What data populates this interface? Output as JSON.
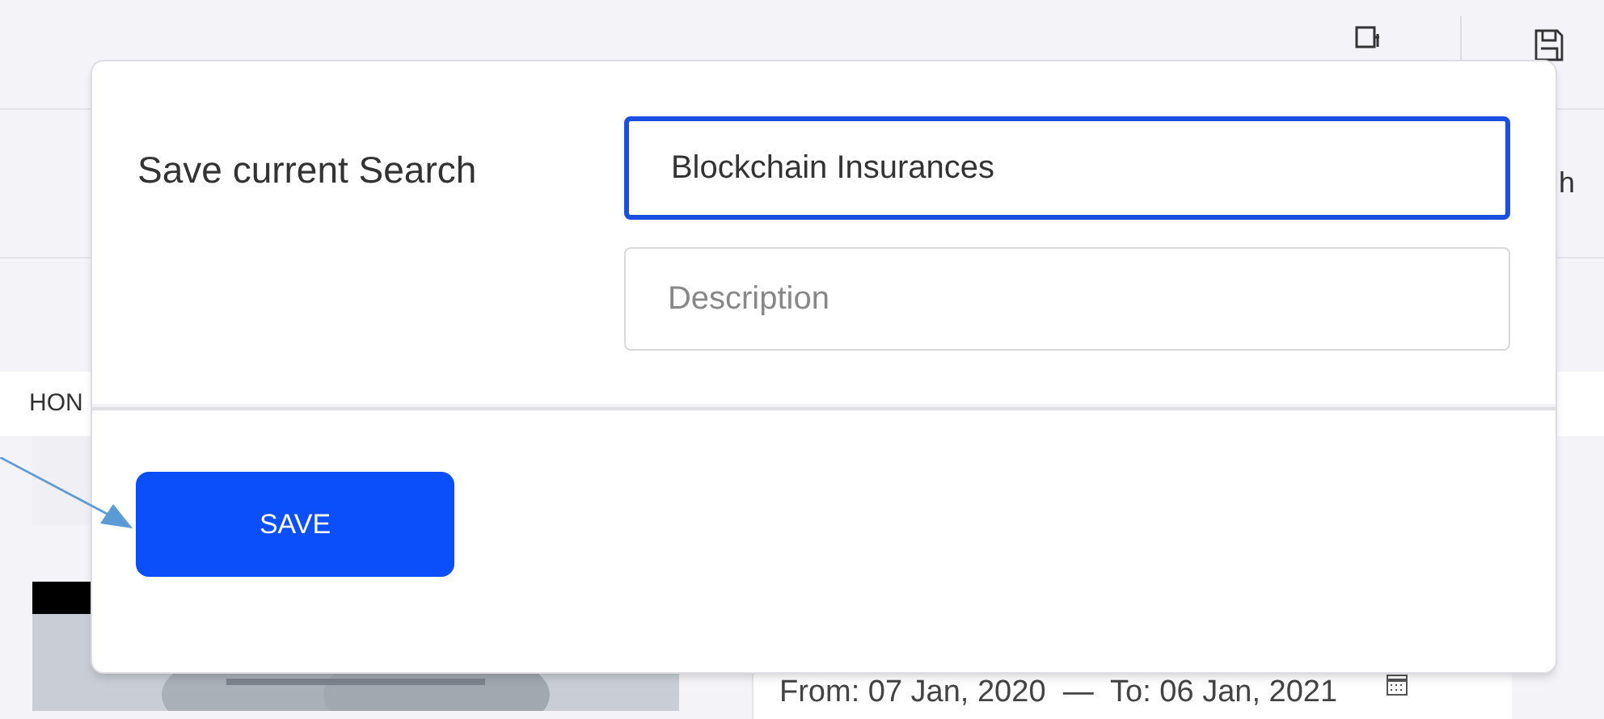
{
  "background": {
    "partial_label_right": "h",
    "partial_label_left": "HON",
    "date_range": "From: 07 Jan, 2020  —  To: 06 Jan, 2021"
  },
  "dialog": {
    "title": "Save current Search",
    "name_field": {
      "value": "Blockchain Insurances",
      "focused": true
    },
    "description_field": {
      "placeholder": "Description"
    },
    "save_button": "SAVE"
  }
}
